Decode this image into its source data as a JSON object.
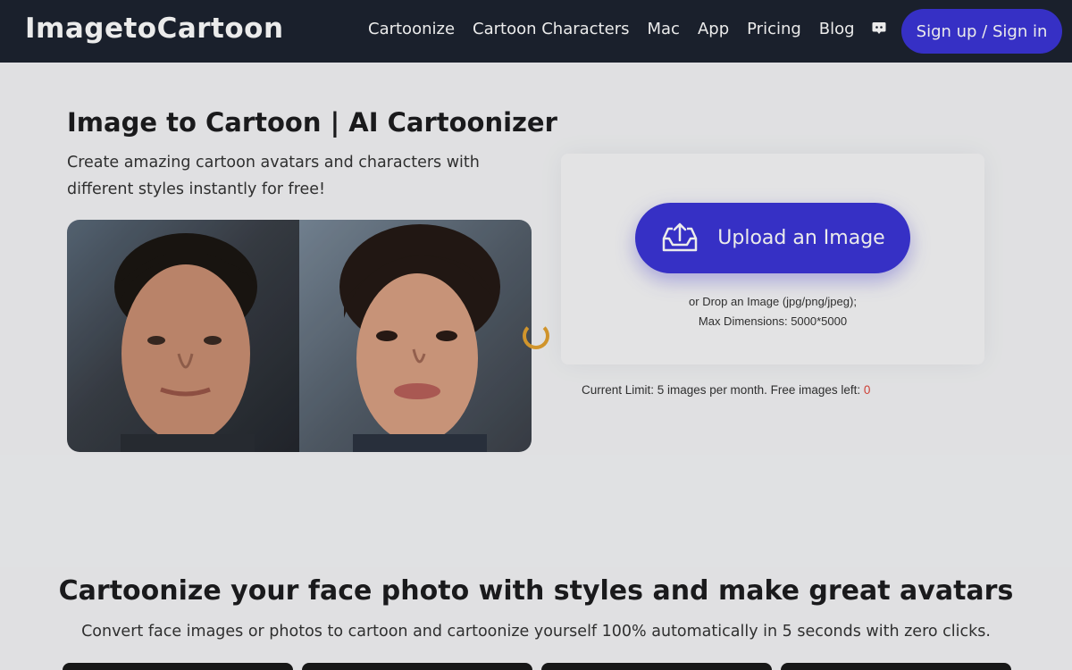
{
  "header": {
    "logo": "ImagetoCartoon",
    "nav": [
      "Cartoonize",
      "Cartoon Characters",
      "Mac",
      "App",
      "Pricing",
      "Blog"
    ],
    "discord_icon": "discord-icon",
    "signin_label": "Sign up / Sign in"
  },
  "hero": {
    "title": "Image to Cartoon | AI Cartoonizer",
    "subtitle": "Create amazing cartoon avatars and characters with different styles instantly for free!"
  },
  "upload": {
    "button_label": "Upload an Image",
    "icon": "inbox-upload-icon",
    "drop_line1": "or Drop an Image (jpg/png/jpeg);",
    "drop_line2": "Max Dimensions: 5000*5000",
    "limit_text": "Current Limit: 5 images per month. Free images left: ",
    "free_left": "0"
  },
  "section": {
    "title": "Cartoonize your face photo with styles and make great avatars",
    "subtitle": "Convert face images or photos to cartoon and cartoonize yourself 100% automatically in 5 seconds with zero clicks."
  },
  "colors": {
    "header_bg": "#1d2330",
    "accent": "#3b35d6",
    "spinner": "#e3a230",
    "zero_count": "#e0453a"
  }
}
